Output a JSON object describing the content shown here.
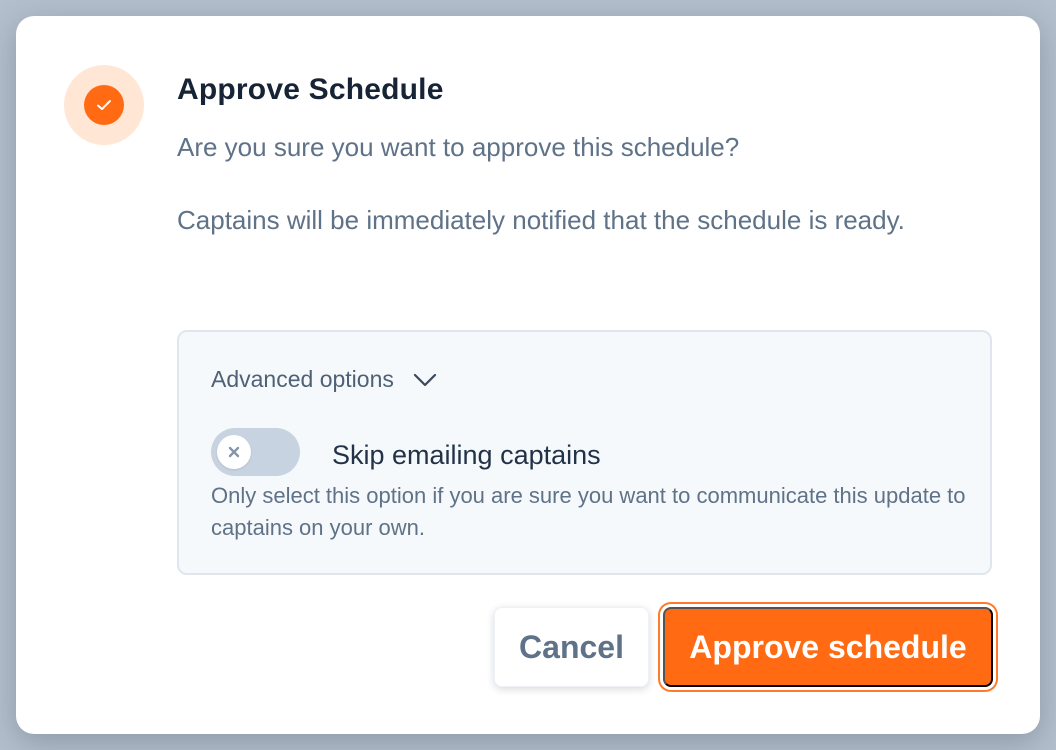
{
  "dialog": {
    "title": "Approve Schedule",
    "question": "Are you sure you want to approve this schedule?",
    "notice": "Captains will be immediately notified that the schedule is ready.",
    "icon": "check-circle-icon",
    "accent_color": "#ff6a13"
  },
  "advanced": {
    "label": "Advanced options",
    "toggle": {
      "label": "Skip emailing captains",
      "checked": false,
      "help": "Only select this option if you are sure you want to communicate this update to captains on your own."
    }
  },
  "actions": {
    "cancel_label": "Cancel",
    "approve_label": "Approve schedule"
  }
}
